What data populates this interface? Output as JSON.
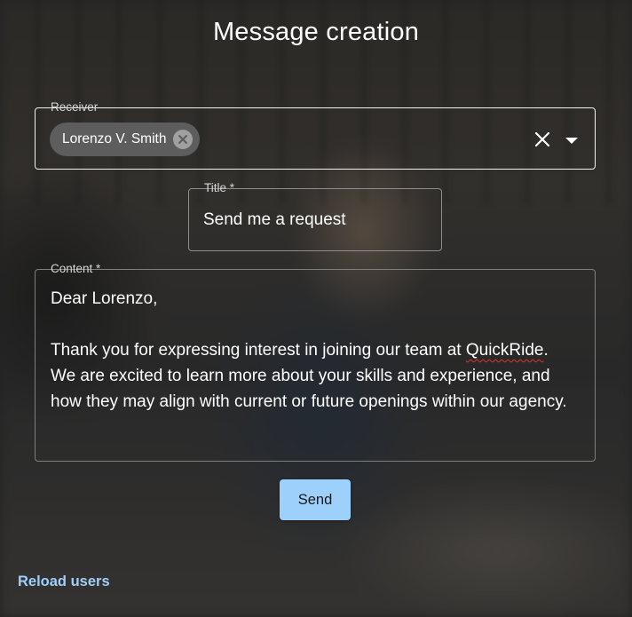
{
  "page": {
    "title": "Message creation"
  },
  "receiver": {
    "label": "Receiver",
    "chips": [
      {
        "label": "Lorenzo V. Smith"
      }
    ]
  },
  "title_field": {
    "label": "Title *",
    "value": "Send me a request"
  },
  "content_field": {
    "label": "Content *",
    "line1": "Dear Lorenzo,",
    "para_before": "Thank you for expressing interest in joining our team at ",
    "misspelled_word": "QuickRide",
    "para_after": ". We are excited to learn more about your skills and experience, and how they may align with current or future openings within our agency."
  },
  "actions": {
    "send_label": "Send",
    "reload_label": "Reload users"
  },
  "icons": {
    "chip_remove": "cancel-circle-icon",
    "clear": "close-icon",
    "dropdown": "arrow-drop-down-icon"
  },
  "colors": {
    "primary_button": "#9dd0fb",
    "link": "#9fd0fb",
    "spellcheck_underline": "#e0312b"
  }
}
